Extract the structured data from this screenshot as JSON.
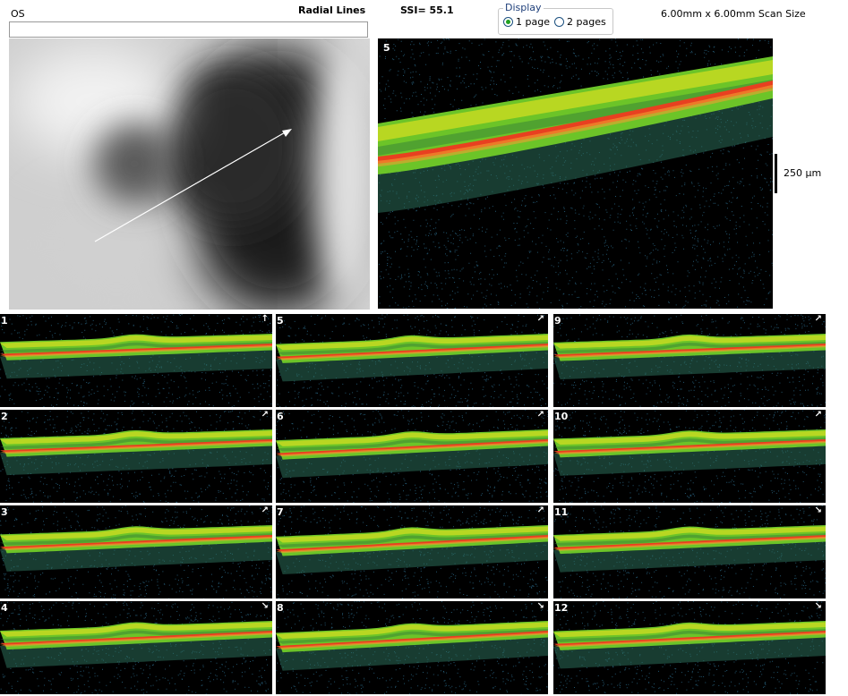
{
  "header": {
    "eye": "OS",
    "scan_type": "Radial Lines",
    "ssi": "SSI= 55.1",
    "scan_size": "6.00mm x 6.00mm Scan Size"
  },
  "display": {
    "legend": "Display",
    "options": [
      "1 page",
      "2 pages"
    ],
    "selected": "1 page"
  },
  "main_scan": {
    "number": "5",
    "scale_label": "250 µm"
  },
  "thumbnails": [
    {
      "number": "1"
    },
    {
      "number": "5"
    },
    {
      "number": "9"
    },
    {
      "number": "2"
    },
    {
      "number": "6"
    },
    {
      "number": "10"
    },
    {
      "number": "3"
    },
    {
      "number": "7"
    },
    {
      "number": "11"
    },
    {
      "number": "4"
    },
    {
      "number": "8"
    },
    {
      "number": "12"
    }
  ],
  "colors": {
    "rpe": "#e84020",
    "retina_green": "#6cc428",
    "retina_yellow": "#d8e020",
    "scatter": "#2a6a8a"
  }
}
